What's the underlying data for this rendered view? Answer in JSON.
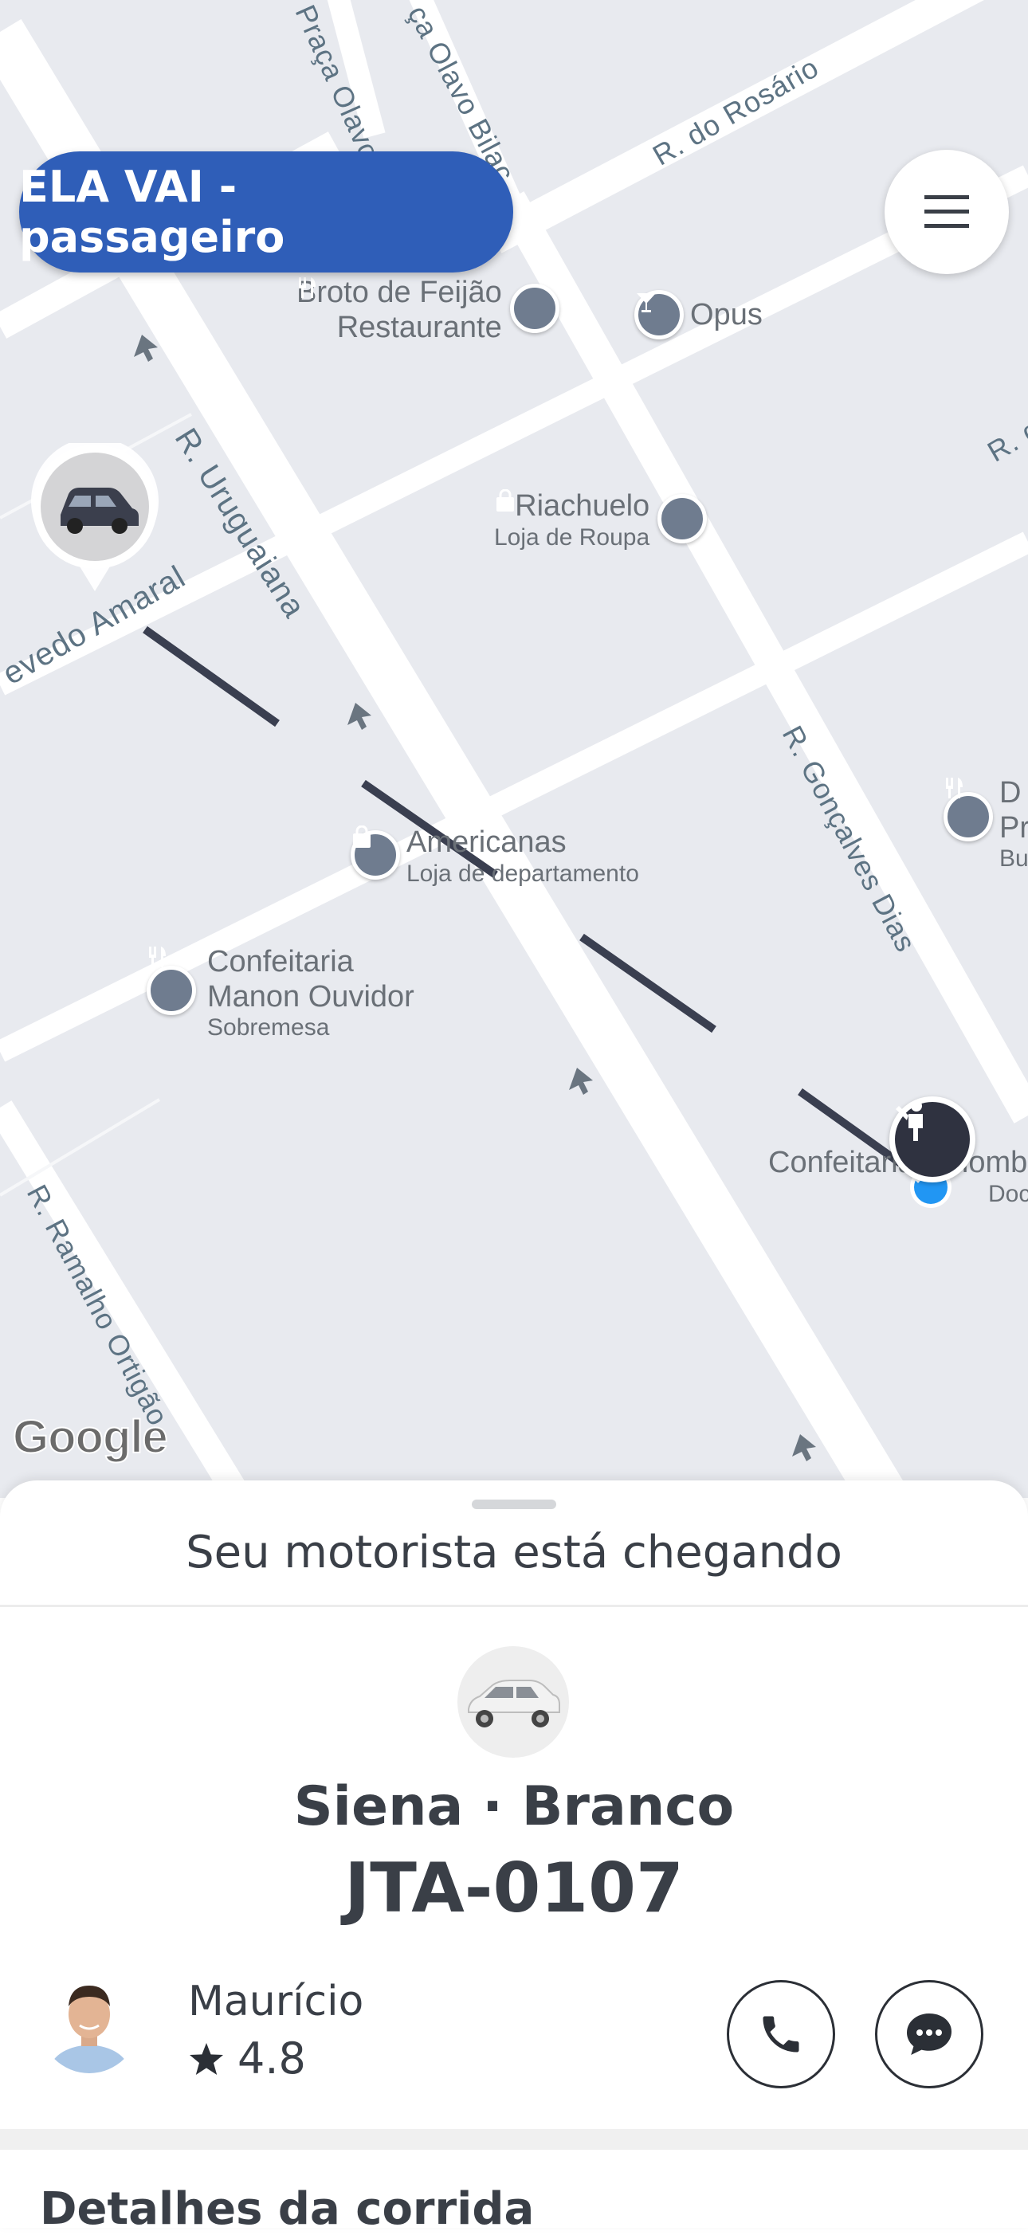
{
  "app": {
    "title": "ELA VAI - passageiro"
  },
  "map": {
    "streets": [
      "Praça Olavo B",
      "ça Olavo Bilac",
      "R. do Rosário",
      "R. Uruguaiana",
      "evedo Amaral",
      "R. Gonçalves Dias",
      "R. Ramalho Ortigão",
      "R. d"
    ],
    "pois": [
      {
        "name": "Broto de Feijão",
        "name2": "Restaurante",
        "icon": "fork-knife-icon"
      },
      {
        "name": "Opus",
        "icon": "cocktail-icon"
      },
      {
        "name": "Riachuelo",
        "sub": "Loja de Roupa",
        "icon": "shopping-bag-icon"
      },
      {
        "name": "Americanas",
        "sub": "Loja de departamento",
        "icon": "shopping-bag-icon"
      },
      {
        "name": "Confeitaria",
        "name2": "Manon Ouvidor",
        "sub": "Sobremesa",
        "icon": "fork-knife-icon"
      },
      {
        "name": "Confeitaria Colomb",
        "sub": "Doc",
        "icon": "fork-knife-icon"
      },
      {
        "name": "D",
        "name2": "Pr",
        "sub": "Bu",
        "icon": "fork-knife-icon"
      }
    ],
    "attribution": "Google"
  },
  "sheet": {
    "status": "Seu motorista está chegando",
    "car_model": "Siena · Branco",
    "plate": "JTA-0107",
    "driver_name": "Maurício",
    "driver_rating": "4.8",
    "details_title": "Detalhes da corrida"
  },
  "colors": {
    "brand": "#2f5eb8",
    "route": "#3a3f50",
    "map_bg": "#e8eaef",
    "pin": "#6f7c8f",
    "pickup": "#2196f3"
  }
}
